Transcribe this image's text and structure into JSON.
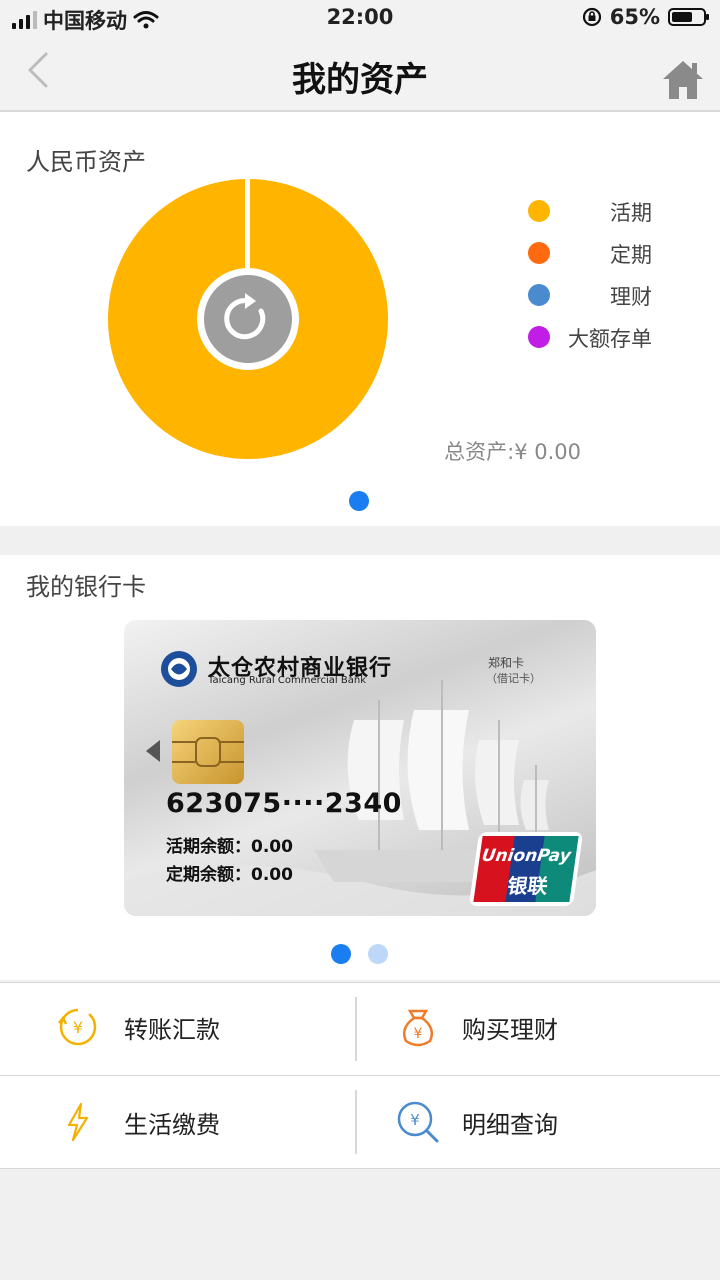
{
  "status_bar": {
    "carrier": "中国移动",
    "time": "22:00",
    "battery": "65%"
  },
  "header": {
    "title": "我的资产"
  },
  "assets": {
    "title": "人民币资产",
    "legend": [
      {
        "label": "活期",
        "color": "#FFB400"
      },
      {
        "label": "定期",
        "color": "#FF6A10"
      },
      {
        "label": "理财",
        "color": "#4A8BD0"
      },
      {
        "label": "大额存单",
        "color": "#C01EE6"
      }
    ],
    "total": "总资产:¥ 0.00",
    "chart_color": "#FFB400"
  },
  "bank_cards": {
    "title": "我的银行卡",
    "card": {
      "bank_name": "太仓农村商业银行",
      "bank_name_en": "Taicang Rural Commercial Bank",
      "card_type": "郑和卡",
      "card_type_sub": "（借记卡）",
      "number": "623075····2340",
      "current_balance_label": "活期余额：",
      "current_balance": "0.00",
      "fixed_balance_label": "定期余额：",
      "fixed_balance": "0.00",
      "unionpay_en": "UnionPay",
      "unionpay_cn": "银联"
    }
  },
  "actions": [
    {
      "label": "转账汇款",
      "icon": "transfer-icon"
    },
    {
      "label": "购买理财",
      "icon": "money-bag-icon"
    },
    {
      "label": "生活缴费",
      "icon": "lightning-icon"
    },
    {
      "label": "明细查询",
      "icon": "search-yuan-icon"
    }
  ]
}
